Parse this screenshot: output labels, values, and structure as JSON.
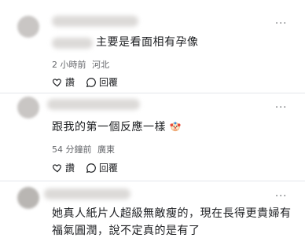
{
  "comments": [
    {
      "text": "主要是看面相有孕像",
      "time": "2 小時前",
      "location": "河北",
      "like_label": "讚",
      "reply_label": "回覆"
    },
    {
      "text": "跟我的第一個反應一樣",
      "emoji": "clown-face-icon",
      "time": "54 分鐘前",
      "location": "廣東",
      "like_label": "讚",
      "reply_label": "回覆"
    },
    {
      "text_line1": "她真人紙片人超級無敵瘦的，現在長得更貴婦有",
      "text_line2": "福氣圓潤，說不定真的是有了"
    }
  ],
  "more_label": "···",
  "colors": {
    "text": "#1c1e21",
    "muted": "#65676b",
    "divider": "#e4e6eb"
  }
}
